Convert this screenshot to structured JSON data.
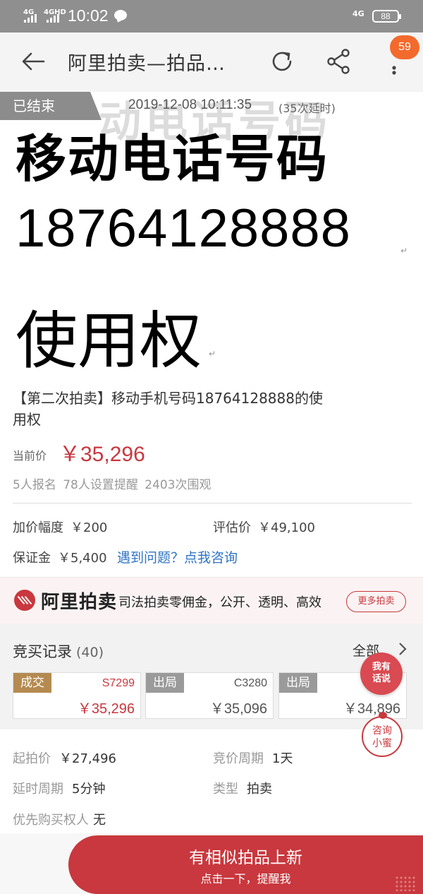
{
  "status_bar": {
    "network_left_1": "4G",
    "network_left_2": "4GHD",
    "time": "10:02",
    "network_right": "4G",
    "battery": "88"
  },
  "nav": {
    "title": "阿里拍卖—拍品…",
    "badge": "59",
    "icons": [
      "back-arrow-icon",
      "refresh-icon",
      "share-icon",
      "more-icon"
    ]
  },
  "hero": {
    "status_tag": "已结束",
    "end_time": "2019-12-08 10:11:35",
    "delay_note": "(35次延时)",
    "bg_text": "动电话号码",
    "line1": "移动电话号码",
    "line2": "18764128888",
    "line3": "使用权"
  },
  "lot": {
    "title": "【第二次拍卖】移动手机号码18764128888的使用权",
    "price_label": "当前价",
    "price": "￥35,296",
    "stats": "5人报名  78人设置提醒  2403次围观"
  },
  "terms": {
    "increment_label": "加价幅度",
    "increment": "￥200",
    "estimate_label": "评估价",
    "estimate": "￥49,100",
    "deposit_label": "保证金",
    "deposit": "￥5,400",
    "help_link": "遇到问题？点我咨询"
  },
  "brand": {
    "name": "阿里拍卖",
    "slogan": "司法拍卖零佣金，公开、透明、高效",
    "more_button": "更多拍卖"
  },
  "bids": {
    "title": "竞买记录",
    "count": "(40)",
    "all_link": "全部",
    "records": [
      {
        "status": "成交",
        "bidder": "S7299",
        "amount": "￥35,296"
      },
      {
        "status": "出局",
        "bidder": "C3280",
        "amount": "￥35,096"
      },
      {
        "status": "出局",
        "bidder": "",
        "amount": "￥34,896"
      }
    ]
  },
  "floating": {
    "talk_line1": "我有",
    "talk_line2": "话说",
    "ask_line1": "咨询",
    "ask_line2": "小蜜"
  },
  "details": {
    "start_price_label": "起拍价",
    "start_price": "￥27,496",
    "cycle_label": "竞价周期",
    "cycle": "1天",
    "delay_label": "延时周期",
    "delay": "5分钟",
    "type_label": "类型",
    "type": "拍卖",
    "priority_label": "优先购买权人",
    "priority": "无"
  },
  "cta": {
    "main": "有相似拍品上新",
    "sub": "点击一下，提醒我"
  },
  "colors": {
    "accent": "#c8383e",
    "link": "#2f74c5",
    "win_tag": "#b58a50",
    "out_tag": "#9a9a9a",
    "badge": "#f36a2d"
  }
}
